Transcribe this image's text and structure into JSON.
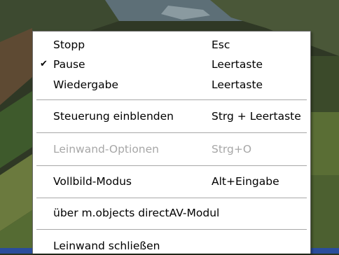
{
  "menu": {
    "items": [
      {
        "label": "Stopp",
        "shortcut": "Esc",
        "checked": false,
        "enabled": true
      },
      {
        "label": "Pause",
        "shortcut": "Leertaste",
        "checked": true,
        "enabled": true
      },
      {
        "label": "Wiedergabe",
        "shortcut": "Leertaste",
        "checked": false,
        "enabled": true
      },
      {
        "label": "Steuerung einblenden",
        "shortcut": "Strg + Leertaste",
        "checked": false,
        "enabled": true
      },
      {
        "label": "Leinwand-Optionen",
        "shortcut": "Strg+O",
        "checked": false,
        "enabled": false
      },
      {
        "label": "Vollbild-Modus",
        "shortcut": "Alt+Eingabe",
        "checked": false,
        "enabled": true
      },
      {
        "label": "über m.objects directAV-Modul",
        "shortcut": "",
        "checked": false,
        "enabled": true
      },
      {
        "label": "Leinwand schließen",
        "shortcut": "",
        "checked": false,
        "enabled": true
      }
    ],
    "check_glyph": "✔"
  },
  "colors": {
    "menu_background": "#ffffff",
    "text": "#000000",
    "disabled_text": "#a7a7a7",
    "separator": "#a8a8a8"
  }
}
